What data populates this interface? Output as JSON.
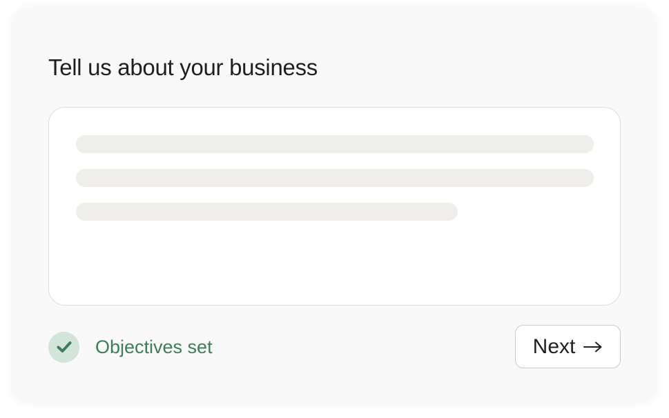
{
  "form": {
    "title": "Tell us about your business"
  },
  "status": {
    "label": "Objectives set",
    "icon": "check-icon",
    "color": "#3e7d5a"
  },
  "actions": {
    "next_label": "Next",
    "next_icon": "arrow-right-icon"
  }
}
